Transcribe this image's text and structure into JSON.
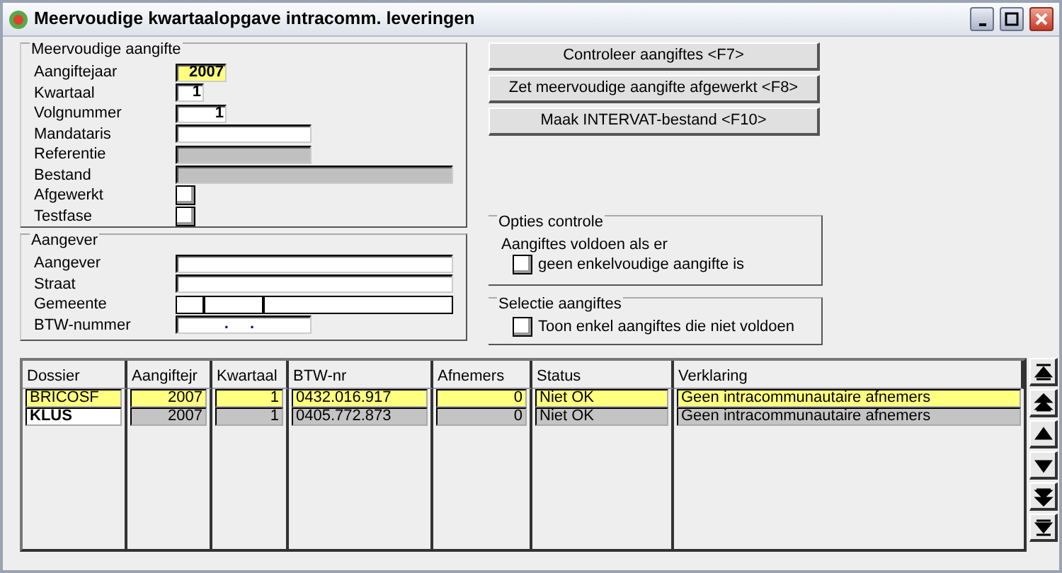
{
  "window": {
    "title": "Meervoudige kwartaalopgave intracomm. leveringen"
  },
  "declaration_group": {
    "title": "Meervoudige aangifte",
    "fields": [
      {
        "label": "Aangiftejaar",
        "kind": "text",
        "value": "2007",
        "focused": true,
        "disabled": false
      },
      {
        "label": "Kwartaal",
        "kind": "text",
        "value": "1",
        "focused": false,
        "disabled": false
      },
      {
        "label": "Volgnummer",
        "kind": "text",
        "value": "1",
        "focused": false,
        "disabled": false
      },
      {
        "label": "Mandataris",
        "kind": "text",
        "focused": false,
        "disabled": false
      },
      {
        "label": "Referentie",
        "kind": "text",
        "focused": false,
        "disabled": true
      },
      {
        "label": "Bestand",
        "kind": "text",
        "focused": false,
        "disabled": true
      },
      {
        "label": "Afgewerkt",
        "kind": "checkbox",
        "checked": false
      },
      {
        "label": "Testfase",
        "kind": "checkbox",
        "checked": false
      }
    ]
  },
  "declarant_group": {
    "title": "Aangever",
    "fields": [
      {
        "label": "Aangever",
        "kind": "text"
      },
      {
        "label": "Straat",
        "kind": "text"
      },
      {
        "label": "Gemeente",
        "kind": "segmented"
      },
      {
        "label": "BTW-nummer",
        "kind": "masked",
        "value": ". ."
      }
    ]
  },
  "buttons": [
    "Controleer aangiftes <F7>",
    "Zet meervoudige aangifte afgewerkt <F8>",
    "Maak INTERVAT-bestand <F10>"
  ],
  "check_options": {
    "title": "Opties controle",
    "text": "Aangiftes voldoen als er",
    "checkbox": {
      "label": "geen enkelvoudige aangifte is",
      "checked": false
    }
  },
  "selection": {
    "title": "Selectie aangiftes",
    "checkbox": {
      "label": "Toon enkel aangiftes die niet voldoen",
      "checked": false
    }
  },
  "table": {
    "columns": [
      "Dossier",
      "Aangiftejr",
      "Kwartaal",
      "BTW-nr",
      "Afnemers",
      "Status",
      "Verklaring"
    ],
    "rows": [
      {
        "selected": true,
        "cells": [
          "BRICOSF",
          "2007",
          "1",
          "0432.016.917",
          "0",
          "Niet OK",
          "Geen intracommunautaire afnemers"
        ]
      },
      {
        "selected": false,
        "cells": [
          "KLUS",
          "2007",
          "1",
          "0405.772.873",
          "0",
          "Niet OK",
          "Geen intracommunautaire afnemers"
        ]
      }
    ]
  }
}
